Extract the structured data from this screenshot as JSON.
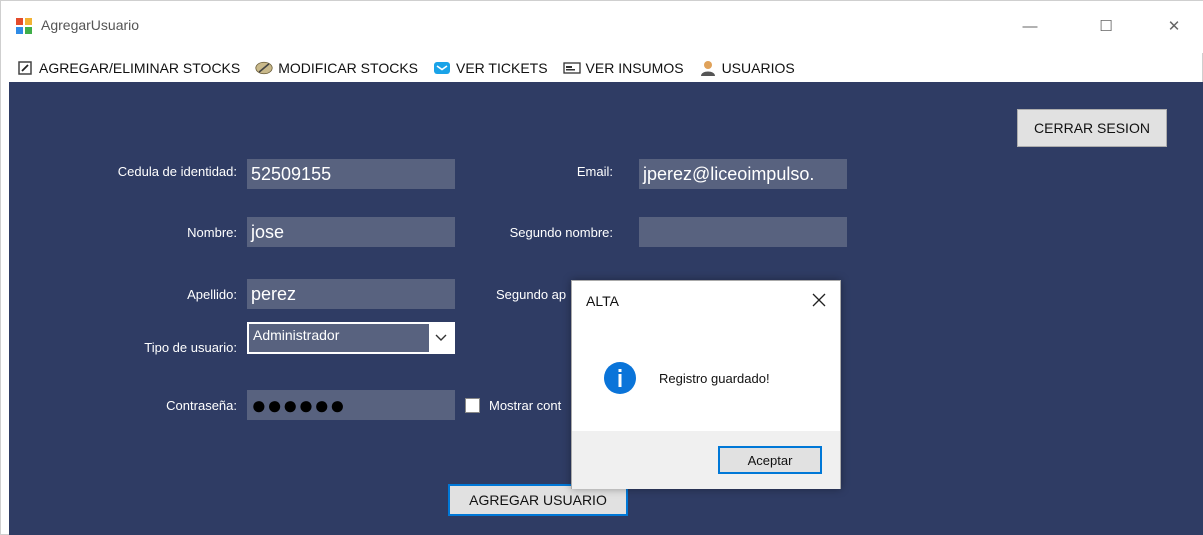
{
  "window": {
    "title": "AgregarUsuario",
    "minimize_glyph": "—",
    "maximize_glyph": "☐",
    "close_glyph": "✕"
  },
  "menu": [
    {
      "label": "AGREGAR/ELIMINAR STOCKS",
      "icon": "edit-doc-icon"
    },
    {
      "label": "MODIFICAR STOCKS",
      "icon": "pencil-icon"
    },
    {
      "label": "VER TICKETS",
      "icon": "envelope-icon"
    },
    {
      "label": "VER INSUMOS",
      "icon": "id-card-icon"
    },
    {
      "label": "USUARIOS",
      "icon": "user-icon"
    }
  ],
  "form": {
    "cedula_label": "Cedula de identidad:",
    "cedula_value": "52509155",
    "nombre_label": "Nombre:",
    "nombre_value": "jose",
    "apellido_label": "Apellido:",
    "apellido_value": "perez",
    "tipo_label": "Tipo de usuario:",
    "tipo_value": "Administrador",
    "password_label": "Contraseña:",
    "password_value": "●●●●●●",
    "email_label": "Email:",
    "email_value": "jperez@liceoimpulso.",
    "segundo_nombre_label": "Segundo nombre:",
    "segundo_nombre_value": "",
    "segundo_apellido_label": "Segundo ap",
    "mostrar_label": "Mostrar cont",
    "logout_label": "CERRAR SESION",
    "add_label": "AGREGAR USUARIO"
  },
  "dialog": {
    "title": "ALTA",
    "message": "Registro guardado!",
    "ok_label": "Aceptar",
    "close_glyph": "✕"
  },
  "colors": {
    "content_bg": "#2f3c64",
    "field_bg": "#58627f",
    "info_blue": "#0a74d9",
    "focus_blue": "#0078d7"
  }
}
